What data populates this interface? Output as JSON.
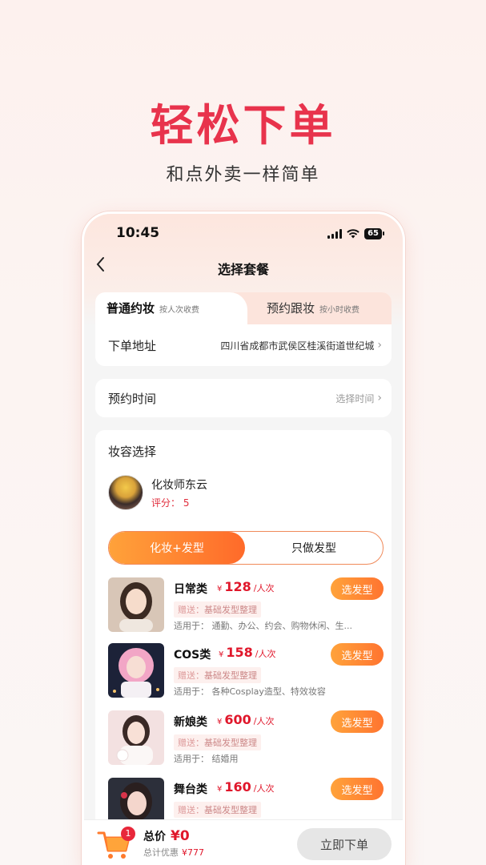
{
  "promo": {
    "title": "轻松下单",
    "subtitle": "和点外卖一样简单"
  },
  "status_bar": {
    "time": "10:45",
    "battery": "65"
  },
  "nav": {
    "back_icon": "chevron-left-icon",
    "title": "选择套餐"
  },
  "tabs": [
    {
      "label": "普通约妆",
      "note": "按人次收费",
      "active": true
    },
    {
      "label": "预约跟妆",
      "note": "按小时收费",
      "active": false
    }
  ],
  "address": {
    "label": "下单地址",
    "value": "四川省成都市武侯区桂溪街道世纪城"
  },
  "appointment": {
    "label": "预约时间",
    "value": "选择时间"
  },
  "makeup": {
    "section_title": "妆容选择",
    "artist_name": "化妆师东云",
    "artist_score": "评分：  5",
    "segments": [
      "化妆+发型",
      "只做发型"
    ],
    "selected_segment": "化妆+发型"
  },
  "packages": [
    {
      "name": "日常类",
      "currency": "¥",
      "price": "128",
      "unit": "/人次",
      "gift_label": "赠送：",
      "gift": "基础发型整理",
      "use": "适用于：  通勤、办公、约会、购物休闲、生...",
      "button": "选发型"
    },
    {
      "name": "COS类",
      "currency": "¥",
      "price": "158",
      "unit": "/人次",
      "gift_label": "赠送：",
      "gift": "基础发型整理",
      "use": "适用于：  各种Cosplay造型、特效妆容",
      "button": "选发型"
    },
    {
      "name": "新娘类",
      "currency": "¥",
      "price": "600",
      "unit": "/人次",
      "gift_label": "赠送：",
      "gift": "基础发型整理",
      "use": "适用于：  结婚用",
      "button": "选发型"
    },
    {
      "name": "舞台类",
      "currency": "¥",
      "price": "160",
      "unit": "/人次",
      "gift_label": "赠送：",
      "gift": "基础发型整理",
      "use": "",
      "button": "选发型"
    }
  ],
  "bottom": {
    "cart_icon": "cart-icon",
    "cart_count": "1",
    "total_label": "总价",
    "total_value": "¥0",
    "discount_label": "总计优惠",
    "discount_value": "¥777",
    "order_button": "立即下单"
  },
  "colors": {
    "brand_red": "#e8334c",
    "accent_orange": "#ff7430",
    "price_red": "#e0172b"
  }
}
